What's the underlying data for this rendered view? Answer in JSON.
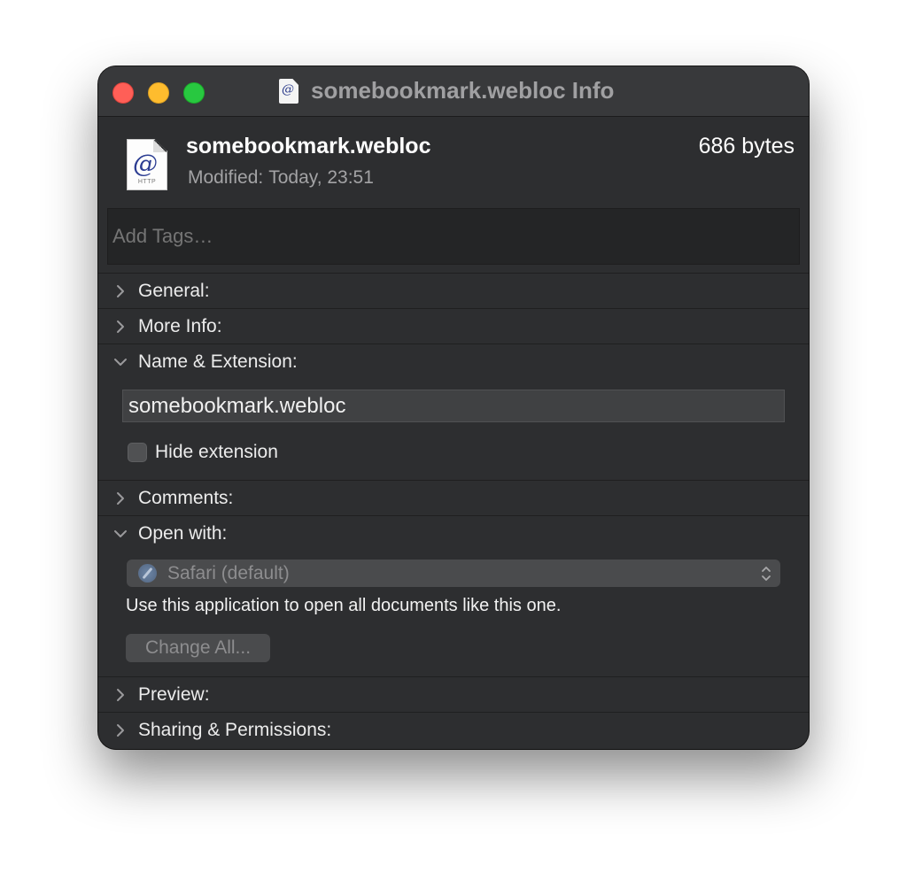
{
  "window": {
    "title": "somebookmark.webloc Info"
  },
  "file": {
    "name": "somebookmark.webloc",
    "size": "686 bytes",
    "modified_label": "Modified:",
    "modified_value": "Today, 23:51",
    "icon_glyph": "@",
    "icon_caption": "HTTP"
  },
  "tags": {
    "placeholder": "Add Tags…"
  },
  "sections": {
    "general": {
      "label": "General:",
      "expanded": false
    },
    "more_info": {
      "label": "More Info:",
      "expanded": false
    },
    "name_extension": {
      "label": "Name & Extension:",
      "expanded": true
    },
    "comments": {
      "label": "Comments:",
      "expanded": false
    },
    "open_with": {
      "label": "Open with:",
      "expanded": true
    },
    "preview": {
      "label": "Preview:",
      "expanded": false
    },
    "sharing": {
      "label": "Sharing & Permissions:",
      "expanded": false
    }
  },
  "name_extension": {
    "value": "somebookmark.webloc",
    "hide_extension_label": "Hide extension",
    "hide_extension_checked": false
  },
  "open_with": {
    "selected_app": "Safari (default)",
    "app_icon": "safari-icon",
    "help_text": "Use this application to open all documents like this one.",
    "change_all_label": "Change All..."
  },
  "colors": {
    "window_bg": "#2d2e30",
    "titlebar_bg": "#38393b",
    "close": "#ff5f57",
    "minimize": "#febc2e",
    "maximize": "#28c840"
  }
}
